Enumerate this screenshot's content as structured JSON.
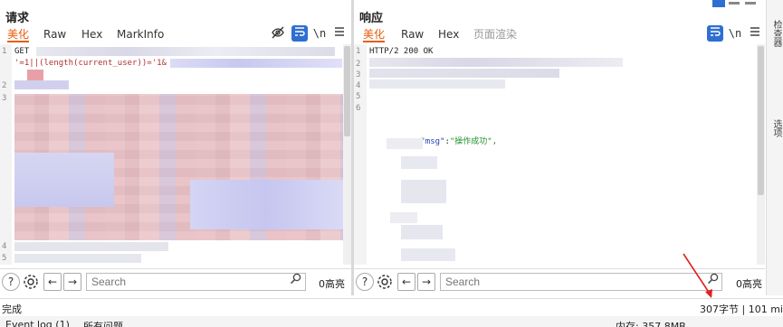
{
  "request": {
    "title": "请求",
    "tabs": [
      "美化",
      "Raw",
      "Hex",
      "MarkInfo"
    ],
    "active_tab": "美化",
    "tool_newline": "\\n",
    "lines": {
      "l1": "GET",
      "l1b": "'=1||(length(current_user))='1&",
      "n1": "1",
      "n2": "2",
      "n3": "3",
      "n4": "4",
      "n5": "5"
    },
    "search": {
      "placeholder": "Search",
      "highlights": "0高亮"
    }
  },
  "response": {
    "title": "响应",
    "tabs": [
      "美化",
      "Raw",
      "Hex",
      "页面渲染"
    ],
    "active_tab": "美化",
    "tool_newline": "\\n",
    "lines": {
      "status": "HTTP/2 200 OK",
      "msg_key": "\"msg\"",
      "msg_sep": ":",
      "msg_val": "\"操作成功\",",
      "n1": "1",
      "n2": "2",
      "n3": "3",
      "n4": "4",
      "n5": "5",
      "n6": "6"
    },
    "search": {
      "placeholder": "Search",
      "highlights": "0高亮"
    }
  },
  "status": {
    "left": "完成",
    "right": "307字节 | 101 mi"
  },
  "bottom": {
    "event_log": "Event log (1)",
    "issues": "所有问题",
    "memory": "内存: 357.8MB"
  },
  "right_edge": {
    "label1": "检查器",
    "label2": "选项"
  },
  "colors": {
    "accent": "#e85c0d",
    "selected": "#2f6fd1",
    "annotation": "#e02020"
  }
}
